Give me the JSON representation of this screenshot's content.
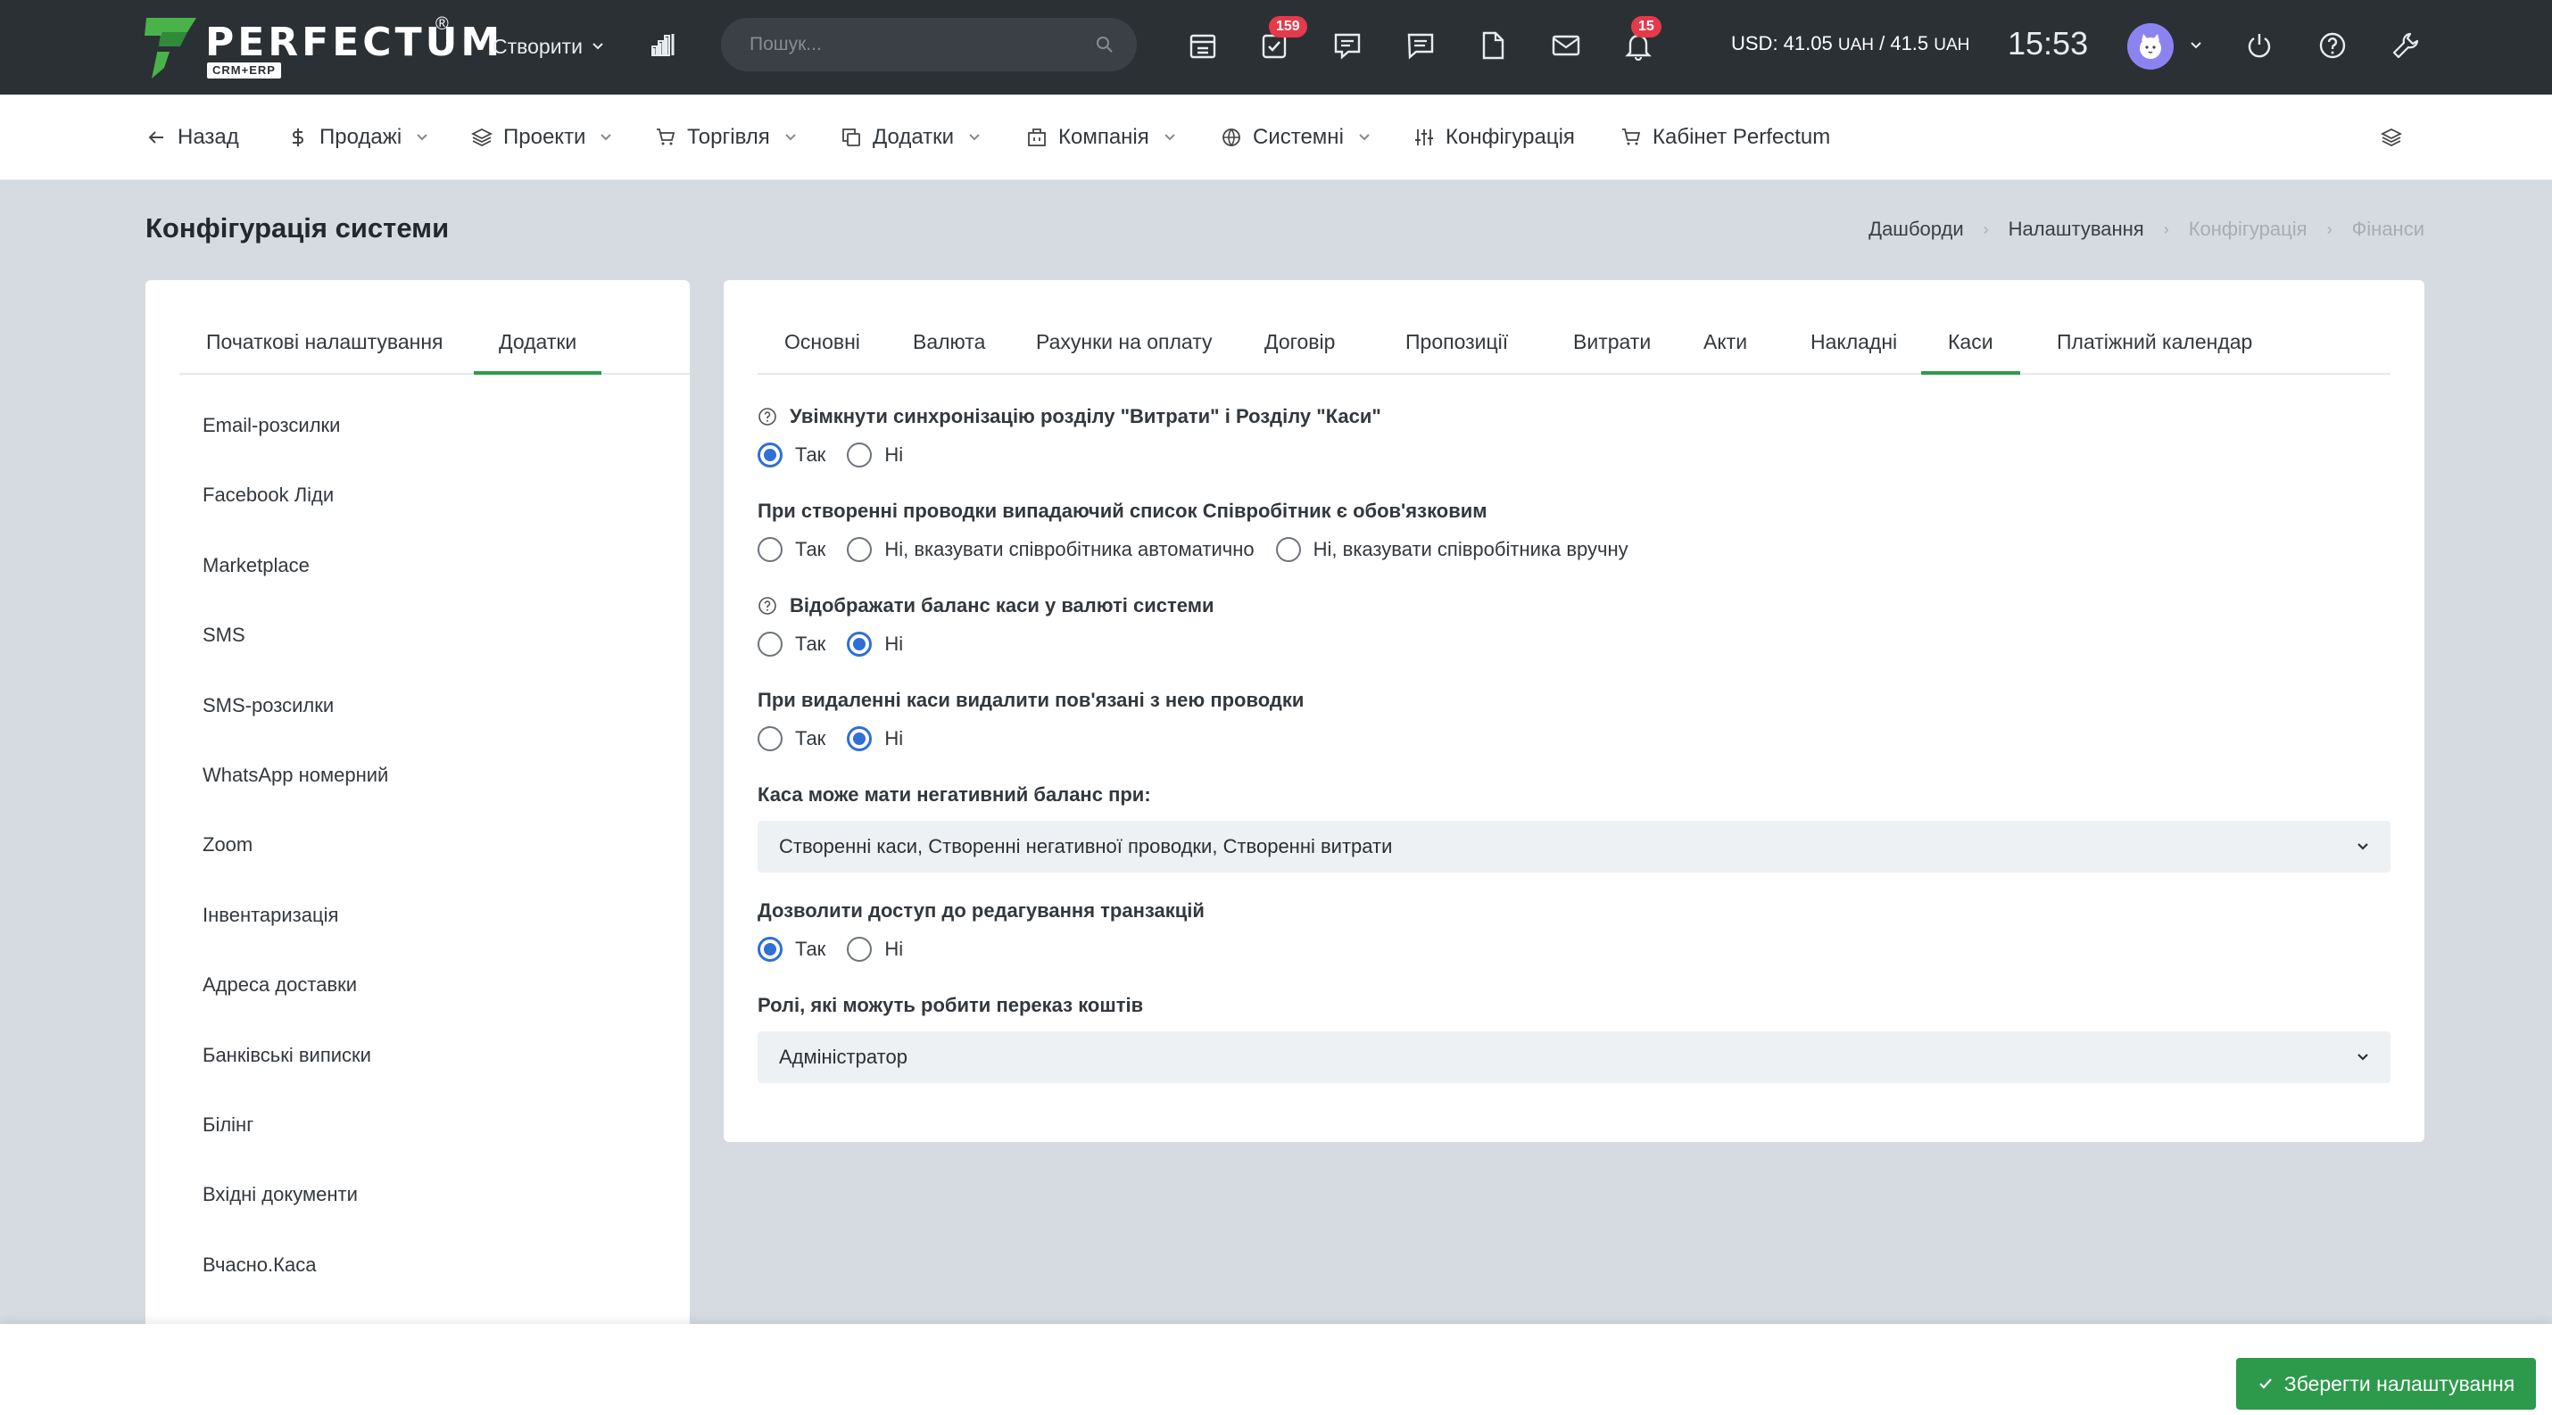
{
  "topbar": {
    "logo_text": "PERFECTUM",
    "logo_reg": "®",
    "logo_sub": "CRM+ERP",
    "create_label": "Створити",
    "search_placeholder": "Пошук...",
    "tasks_badge": "159",
    "notifications_badge": "15",
    "currency_usd": "USD: 41.05",
    "currency_uah1": "UAH",
    "currency_sep": "/ 41.5",
    "currency_uah2": "UAH",
    "time": "15:53"
  },
  "menu": {
    "back": "Назад",
    "sales": "Продажі",
    "projects": "Проекти",
    "trade": "Торгівля",
    "addons": "Додатки",
    "company": "Компанія",
    "system": "Системні",
    "config": "Конфігурація",
    "cabinet": "Кабінет Perfectum"
  },
  "page": {
    "title": "Конфігурація системи",
    "breadcrumb": [
      "Дашборди",
      "Налаштування",
      "Конфігурація",
      "Фінанси"
    ]
  },
  "left": {
    "tabs": [
      "Початкові налаштування",
      "Додатки"
    ],
    "items": [
      "Email-розсилки",
      "Facebook Ліди",
      "Marketplace",
      "SMS",
      "SMS-розсилки",
      "WhatsApp номерний",
      "Zoom",
      "Інвентаризація",
      "Адреса доставки",
      "Банківські виписки",
      "Білінг",
      "Вхідні документи",
      "Вчасно.Каса"
    ]
  },
  "right": {
    "tabs": [
      "Основні",
      "Валюта",
      "Рахунки на оплату",
      "Договір",
      "Пропозиції",
      "Витрати",
      "Акти",
      "Накладні",
      "Каси",
      "Платіжний календар"
    ],
    "f1_label": "Увімкнути синхронізацію розділу \"Витрати\" і Розділу \"Каси\"",
    "f2_label": "При створенні проводки випадаючий список Співробітник є обов'язковим",
    "f3_label": "Відображати баланс каси у валюті системи",
    "f4_label": "При видаленні каси видалити пов'язані з нею проводки",
    "f5_label": "Каса може мати негативний баланс при:",
    "f5_value": "Створенні каси, Створенні негативної проводки, Створенні витрати",
    "f6_label": "Дозволити доступ до редагування транзакцій",
    "f7_label": "Ролі, які можуть робити переказ коштів",
    "f7_value": "Адміністратор",
    "yes": "Так",
    "no": "Ні",
    "no_auto": "Ні, вказувати співробітника автоматично",
    "no_manual": "Ні, вказувати співробітника вручну"
  },
  "footer": {
    "save_label": "Зберегти налаштування"
  },
  "colors": {
    "topbar": "#2b3035",
    "accent_green": "#2d9a4b",
    "radio_blue": "#2f6fd6",
    "badge_red": "#e53a4b"
  }
}
